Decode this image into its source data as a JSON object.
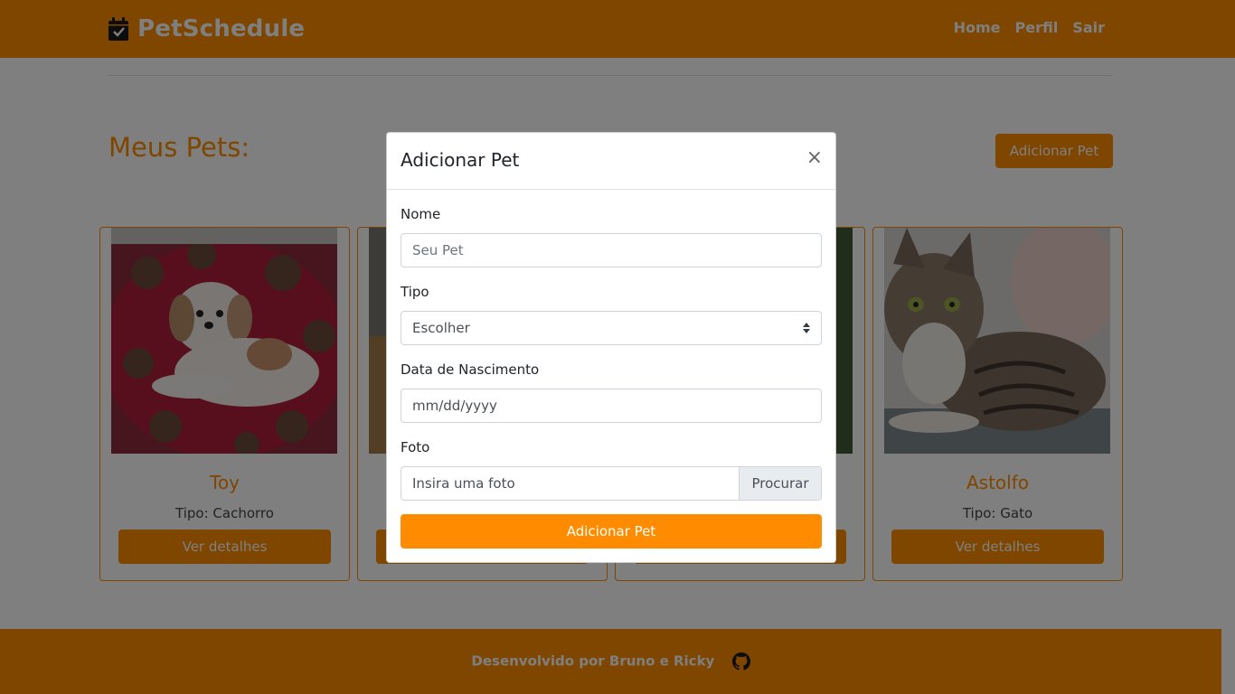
{
  "navbar": {
    "brand": "PetSchedule",
    "brand_icon": "calendar-check-icon",
    "links": [
      "Home",
      "Perfil",
      "Sair"
    ]
  },
  "main": {
    "title": "Meus Pets:",
    "add_button": "Adicionar Pet",
    "pets": [
      {
        "name": "Toy",
        "type": "Tipo: Cachorro",
        "button": "Ver detalhes",
        "photo": "dog-photo"
      },
      {
        "name": "",
        "type": "",
        "button": "",
        "photo": "pet-photo"
      },
      {
        "name": "",
        "type": "",
        "button": "",
        "photo": "pet-photo"
      },
      {
        "name": "Astolfo",
        "type": "Tipo: Gato",
        "button": "Ver detalhes",
        "photo": "cat-photo"
      }
    ]
  },
  "footer": {
    "text": "Desenvolvido por Bruno e Ricky",
    "icon": "github-icon"
  },
  "modal": {
    "title": "Adicionar Pet",
    "close": "×",
    "fields": {
      "name_label": "Nome",
      "name_placeholder": "Seu Pet",
      "type_label": "Tipo",
      "type_value": "Escolher",
      "birth_label": "Data de Nascimento",
      "birth_placeholder": "mm/dd/yyyy",
      "photo_label": "Foto",
      "photo_placeholder": "Insira uma foto",
      "photo_browse": "Procurar"
    },
    "submit": "Adicionar Pet"
  },
  "colors": {
    "brand": "#ff8c00",
    "overlay": "rgba(0,0,0,0.5)"
  }
}
